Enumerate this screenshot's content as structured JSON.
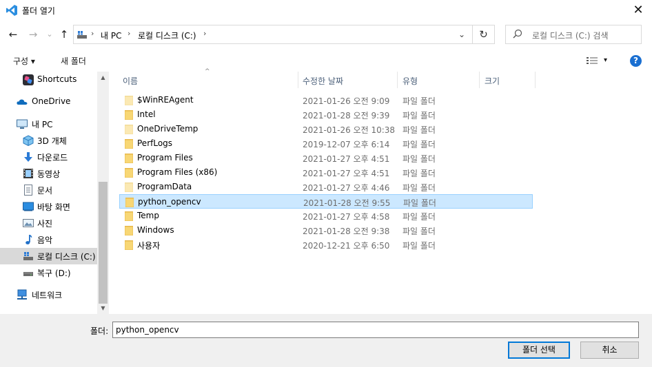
{
  "window": {
    "title": "폴더 열기",
    "close_label": "✕"
  },
  "nav": {
    "back": "←",
    "forward": "→",
    "recent": "⌄",
    "up": "↑"
  },
  "address": {
    "crumbs": [
      "내 PC",
      "로컬 디스크 (C:)"
    ],
    "refresh": "↻"
  },
  "search": {
    "placeholder": "로컬 디스크 (C:) 검색"
  },
  "toolbar": {
    "organize_label": "구성 ▾",
    "new_folder_label": "새 폴더",
    "view_label": "▾",
    "help_label": "?"
  },
  "sidebar": {
    "items": [
      {
        "label": "Shortcuts",
        "icon": "shortcuts-icon"
      },
      {
        "label": "OneDrive",
        "icon": "cloud-icon"
      },
      {
        "label": "내 PC",
        "icon": "pc-icon"
      },
      {
        "label": "3D 개체",
        "icon": "cube-3d-icon"
      },
      {
        "label": "다운로드",
        "icon": "download-icon"
      },
      {
        "label": "동영상",
        "icon": "video-icon"
      },
      {
        "label": "문서",
        "icon": "document-icon"
      },
      {
        "label": "바탕 화면",
        "icon": "desktop-icon"
      },
      {
        "label": "사진",
        "icon": "picture-icon"
      },
      {
        "label": "음악",
        "icon": "music-icon"
      },
      {
        "label": "로컬 디스크 (C:)",
        "icon": "drive-icon"
      },
      {
        "label": "복구 (D:)",
        "icon": "drive-icon"
      },
      {
        "label": "네트워크",
        "icon": "network-icon"
      }
    ]
  },
  "columns": {
    "name": "이름",
    "date": "수정한 날짜",
    "type": "유형",
    "size": "크기"
  },
  "files": [
    {
      "name": "$WinREAgent",
      "date": "2021-01-26 오전 9:09",
      "type": "파일 폴더",
      "faded": true
    },
    {
      "name": "Intel",
      "date": "2021-01-28 오전 9:39",
      "type": "파일 폴더",
      "faded": false
    },
    {
      "name": "OneDriveTemp",
      "date": "2021-01-26 오전 10:38",
      "type": "파일 폴더",
      "faded": true
    },
    {
      "name": "PerfLogs",
      "date": "2019-12-07 오후 6:14",
      "type": "파일 폴더",
      "faded": false
    },
    {
      "name": "Program Files",
      "date": "2021-01-27 오후 4:51",
      "type": "파일 폴더",
      "faded": false
    },
    {
      "name": "Program Files (x86)",
      "date": "2021-01-27 오후 4:51",
      "type": "파일 폴더",
      "faded": false
    },
    {
      "name": "ProgramData",
      "date": "2021-01-27 오후 4:46",
      "type": "파일 폴더",
      "faded": true
    },
    {
      "name": "python_opencv",
      "date": "2021-01-28 오전 9:55",
      "type": "파일 폴더",
      "faded": false
    },
    {
      "name": "Temp",
      "date": "2021-01-27 오후 4:58",
      "type": "파일 폴더",
      "faded": false
    },
    {
      "name": "Windows",
      "date": "2021-01-28 오전 9:38",
      "type": "파일 폴더",
      "faded": false
    },
    {
      "name": "사용자",
      "date": "2020-12-21 오후 6:50",
      "type": "파일 폴더",
      "faded": false
    }
  ],
  "footer": {
    "folder_label": "폴더:",
    "folder_value": "python_opencv",
    "select_button": "폴더 선택",
    "cancel_button": "취소"
  },
  "colors": {
    "accent": "#0078d7",
    "selection": "#cce8ff",
    "folder": "#f8d775"
  }
}
